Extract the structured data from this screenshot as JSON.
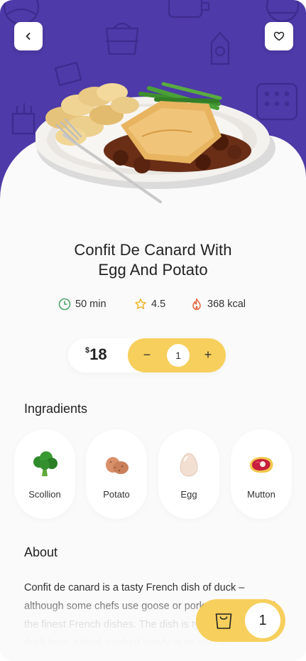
{
  "header": {
    "back_icon": "chevron-left-icon",
    "favorite_icon": "heart-icon",
    "colors": {
      "hero_background": "#4e3aa8"
    }
  },
  "dish": {
    "title_line1": "Confit De Canard With",
    "title_line2": "Egg And Potato"
  },
  "stats": {
    "time": "50 min",
    "rating": "4.5",
    "calories": "368 kcal"
  },
  "order": {
    "currency": "$",
    "price": "18",
    "minus": "−",
    "quantity": "1",
    "plus": "+",
    "accent_color": "#f6cf5c"
  },
  "ingredients": {
    "title": "Ingradients",
    "items": [
      {
        "label": "Scollion",
        "icon": "broccoli-icon"
      },
      {
        "label": "Potato",
        "icon": "potato-icon"
      },
      {
        "label": "Egg",
        "icon": "egg-icon"
      },
      {
        "label": "Mutton",
        "icon": "steak-icon"
      }
    ]
  },
  "about": {
    "title": "About",
    "text": "Confit de canard is a tasty French dish of duck – although some chefs use goose or pork – and is one of the finest French dishes. The dish is typically made of duck legs, salted, cooked slowly in its own fat."
  },
  "cart": {
    "icon": "shopping-bag-icon",
    "count": "1"
  }
}
